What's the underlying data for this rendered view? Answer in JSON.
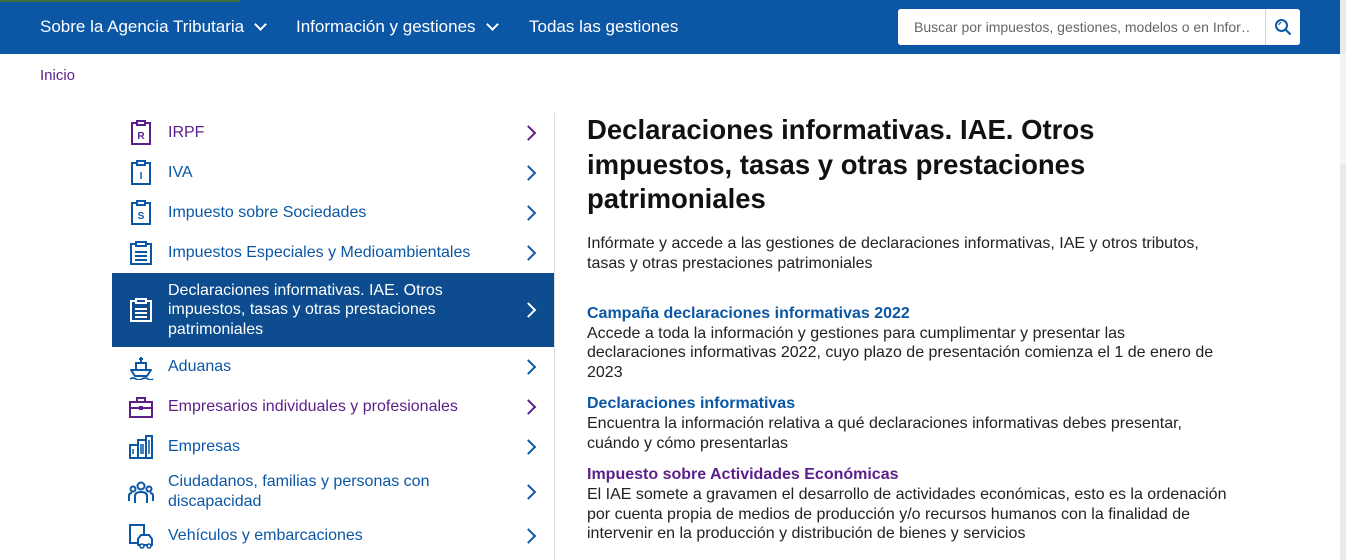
{
  "topbar": {
    "nav": [
      {
        "label": "Sobre la Agencia Tributaria",
        "has_dropdown": true
      },
      {
        "label": "Información y gestiones",
        "has_dropdown": true
      },
      {
        "label": "Todas las gestiones",
        "has_dropdown": false
      }
    ],
    "search": {
      "placeholder": "Buscar por impuestos, gestiones, modelos o en Infor…",
      "icon": "search-icon"
    },
    "color": "#0c57a5"
  },
  "breadcrumb": {
    "home": "Inicio"
  },
  "sidebar": {
    "items": [
      {
        "label": "IRPF",
        "icon": "irpf-document-icon",
        "visited": true
      },
      {
        "label": "IVA",
        "icon": "iva-document-icon",
        "visited": false
      },
      {
        "label": "Impuesto sobre Sociedades",
        "icon": "sociedades-document-icon",
        "visited": false
      },
      {
        "label": "Impuestos Especiales y Medioambientales",
        "icon": "clipboard-icon",
        "visited": false
      },
      {
        "label": "Declaraciones informativas. IAE. Otros impuestos, tasas y otras prestaciones patrimoniales",
        "icon": "clipboard-icon",
        "active": true
      },
      {
        "label": "Aduanas",
        "icon": "ship-icon",
        "visited": false
      },
      {
        "label": "Empresarios individuales y profesionales",
        "icon": "briefcase-icon",
        "visited": true
      },
      {
        "label": "Empresas",
        "icon": "buildings-icon",
        "visited": false
      },
      {
        "label": "Ciudadanos, familias y personas con discapacidad",
        "icon": "people-icon",
        "visited": false
      },
      {
        "label": "Vehículos y embarcaciones",
        "icon": "vehicle-document-icon",
        "visited": false
      }
    ]
  },
  "main": {
    "title": "Declaraciones informativas. IAE. Otros impuestos, tasas y otras prestaciones patrimoniales",
    "intro": "Infórmate y accede a las gestiones de declaraciones informativas, IAE y otros tributos, tasas y otras prestaciones patrimoniales",
    "blocks": [
      {
        "title": "Campaña declaraciones informativas 2022",
        "desc": "Accede a toda la información y gestiones para cumplimentar y presentar las declaraciones informativas 2022, cuyo plazo de presentación comienza el 1 de enero de 2023",
        "visited": false
      },
      {
        "title": "Declaraciones informativas",
        "desc": "Encuentra la información relativa a qué declaraciones informativas debes presentar, cuándo y cómo presentarlas",
        "visited": false
      },
      {
        "title": "Impuesto sobre Actividades Económicas",
        "desc": "El IAE somete a gravamen el desarrollo de actividades económicas, esto es la ordenación por cuenta propia de medios de producción y/o recursos humanos con la finalidad de intervenir en la producción y distribución de bienes y servicios",
        "visited": true
      }
    ]
  },
  "colors": {
    "link": "#0c57a5",
    "visited": "#5c1f8a",
    "active_bg": "#0c4c8f"
  }
}
